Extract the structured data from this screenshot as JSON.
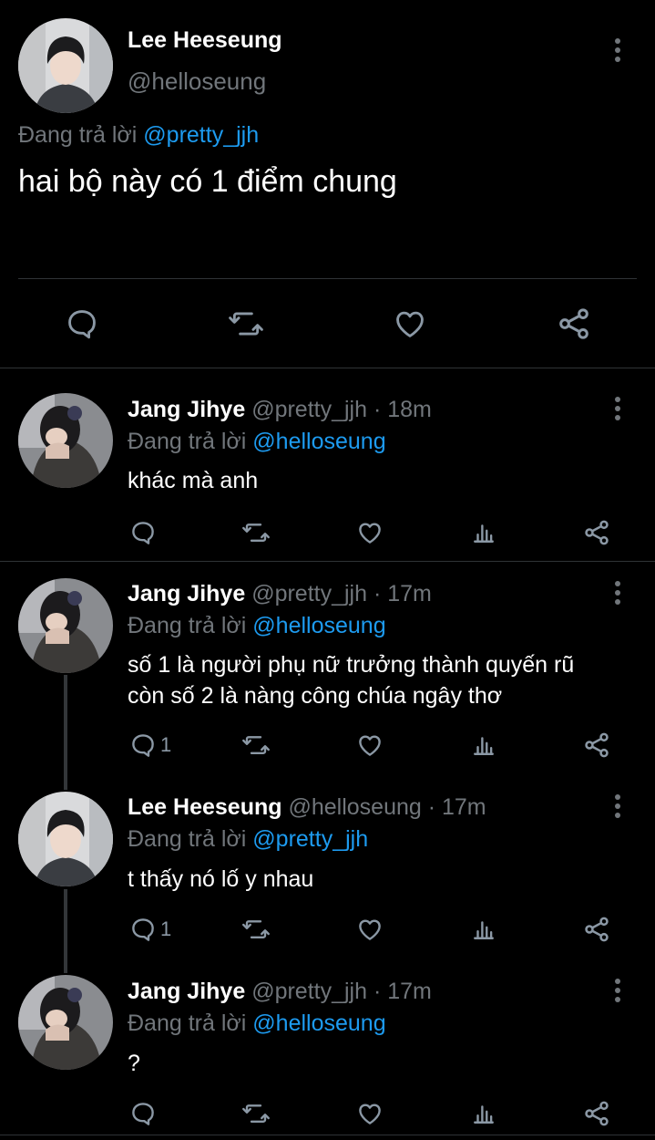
{
  "main_tweet": {
    "name": "Lee Heeseung",
    "handle": "@helloseung",
    "reply_prefix": "Đang trả lời",
    "reply_to": "@pretty_jjh",
    "text": "hai bộ này có 1 điểm chung"
  },
  "replies": [
    {
      "name": "Jang Jihye",
      "meta": "@pretty_jjh · 18m",
      "reply_prefix": "Đang trả lời",
      "reply_to": "@helloseung",
      "line1": "khác mà anh",
      "line2": "",
      "reply_count": ""
    },
    {
      "name": "Jang Jihye",
      "meta": "@pretty_jjh · 17m",
      "reply_prefix": "Đang trả lời",
      "reply_to": "@helloseung",
      "line1": "số 1 là người phụ nữ trưởng thành quyến rũ",
      "line2": "còn số 2 là nàng công chúa ngây thơ",
      "reply_count": "1"
    },
    {
      "name": "Lee Heeseung",
      "meta": "@helloseung · 17m",
      "reply_prefix": "Đang trả lời",
      "reply_to": "@pretty_jjh",
      "line1": "t thấy nó lố y nhau",
      "line2": "",
      "reply_count": "1"
    },
    {
      "name": "Jang Jihye",
      "meta": "@pretty_jjh · 17m",
      "reply_prefix": "Đang trả lời",
      "reply_to": "@helloseung",
      "line1": "?",
      "line2": "",
      "reply_count": ""
    }
  ],
  "icons": {
    "reply": "speech-bubble-icon",
    "retweet": "retweet-icon",
    "like": "heart-icon",
    "views": "bar-chart-icon",
    "share": "share-icon",
    "more": "vertical-dots-icon"
  },
  "colors": {
    "background": "#000000",
    "primary_text": "#ffffff",
    "secondary_text": "#71767b",
    "link": "#1d9bf0",
    "divider": "#2f3336"
  }
}
